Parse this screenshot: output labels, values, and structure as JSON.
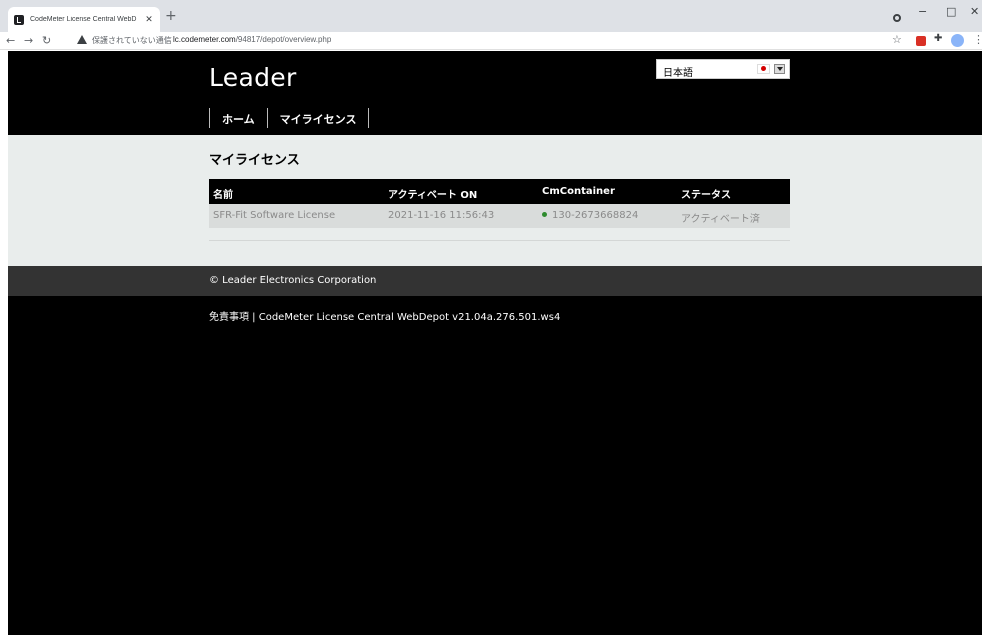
{
  "browser": {
    "tab_title": "CodeMeter License Central WebD",
    "tab_close": "✕",
    "new_tab": "+",
    "security_text": "保護されていない通信",
    "address_separator": "|",
    "url_host": "lc.codemeter.com",
    "url_path": "/94817/depot/overview.php",
    "window_controls": {
      "minimize": "−",
      "maximize": "□",
      "close": "✕"
    }
  },
  "site": {
    "logo": "Leader",
    "nav": [
      "ホーム",
      "マイライセンス"
    ],
    "language": {
      "selected": "日本語"
    }
  },
  "main": {
    "title": "マイライセンス",
    "table": {
      "headers": [
        "名前",
        "アクティベート ON",
        "CmContainer",
        "ステータス"
      ],
      "rows": [
        {
          "name": "SFR-Fit Software License",
          "activated_on": "2021-11-16 11:56:43",
          "container": "130-2673668824",
          "status": "アクティベート済"
        }
      ]
    }
  },
  "footer": {
    "copyright": "© Leader Electronics Corporation",
    "disclaimer": "免責事項",
    "separator": " | ",
    "version": "CodeMeter License Central WebDepot v21.04a.276.501.ws4"
  },
  "colors": {
    "header_bg": "#000000",
    "content_bg": "#e9edec",
    "footer_bg": "#333333",
    "status_active": "#2e8b2e"
  },
  "icons": {
    "favicon": "codemeter-favicon",
    "back": "back-arrow-icon",
    "forward": "forward-arrow-icon",
    "reload": "reload-icon",
    "security": "warning-triangle-icon",
    "bookmark": "star-icon",
    "language_flag": "japan-flag-icon",
    "dropdown": "chevron-down-icon"
  }
}
